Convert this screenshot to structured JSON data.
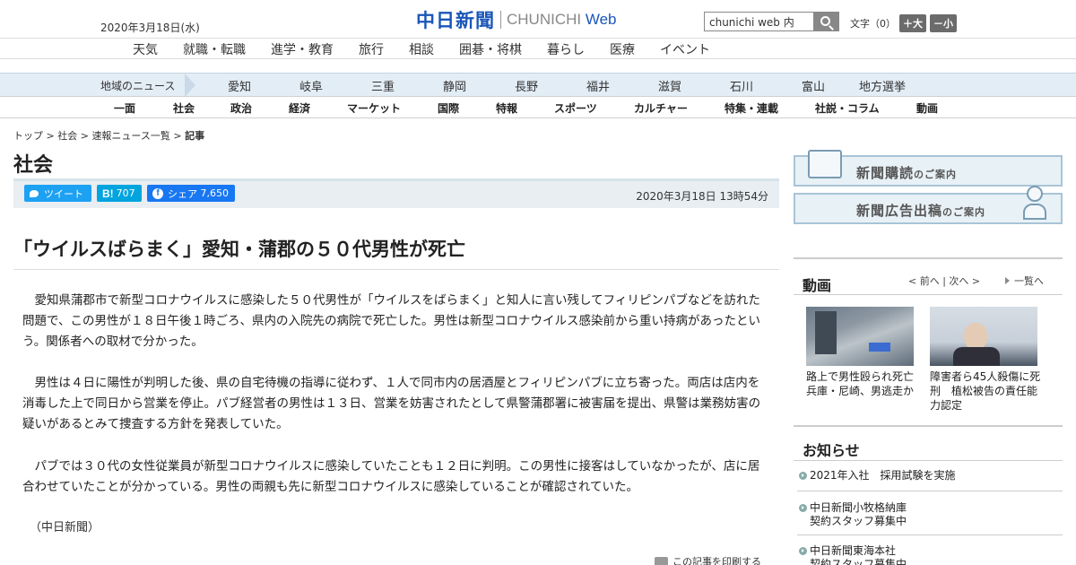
{
  "header": {
    "date": "2020年3月18日(水)",
    "logo_jp": "中日新聞",
    "logo_en_prefix": "CHUNICHI",
    "logo_en_suffix": "Web",
    "search_value": "chunichi web 内",
    "fontsize_label": "文字（0）",
    "fontsize_up": "＋大",
    "fontsize_down": "－小"
  },
  "topnav": [
    "天気",
    "就職・転職",
    "進学・教育",
    "旅行",
    "相談",
    "囲碁・将棋",
    "暮らし",
    "医療",
    "イベント"
  ],
  "region": {
    "label": "地域のニュース",
    "items": [
      "愛知",
      "岐阜",
      "三重",
      "静岡",
      "長野",
      "福井",
      "滋賀",
      "石川",
      "富山",
      "地方選挙"
    ]
  },
  "sections": [
    "一面",
    "社会",
    "政治",
    "経済",
    "マーケット",
    "国際",
    "特報",
    "スポーツ",
    "カルチャー",
    "特集・連載",
    "社説・コラム",
    "動画"
  ],
  "breadcrumb": {
    "top": "トップ",
    "sep": " > ",
    "society": "社会",
    "breaking": "速報ニュース一覧",
    "current": "記事"
  },
  "section_title": "社会",
  "share": {
    "tweet": "ツイート",
    "hatena_count": "707",
    "fb_label": "シェア",
    "fb_count": "7,650"
  },
  "pubdate": "2020年3月18日 13時54分",
  "article": {
    "headline": "「ウイルスばらまく」愛知・蒲郡の５０代男性が死亡",
    "paragraphs": [
      "愛知県蒲郡市で新型コロナウイルスに感染した５０代男性が「ウイルスをばらまく」と知人に言い残してフィリピンパブなどを訪れた問題で、この男性が１８日午後１時ごろ、県内の入院先の病院で死亡した。男性は新型コロナウイルス感染前から重い持病があったという。関係者への取材で分かった。",
      "男性は４日に陽性が判明した後、県の自宅待機の指導に従わず、１人で同市内の居酒屋とフィリピンパブに立ち寄った。両店は店内を消毒した上で同日から営業を停止。パブ経営者の男性は１３日、営業を妨害されたとして県警蒲郡署に被害届を提出、県警は業務妨害の疑いがあるとみて捜査する方針を発表していた。",
      "パブでは３０代の女性従業員が新型コロナウイルスに感染していたことも１２日に判明。この男性に接客はしていなかったが、店に居合わせていたことが分かっている。男性の両親も先に新型コロナウイルスに感染していることが確認されていた。"
    ],
    "credit": "（中日新聞）",
    "print": "この記事を印刷する"
  },
  "sidebar": {
    "banner1_main": "新聞購読",
    "banner1_sub": "のご案内",
    "banner2_main": "新聞広告出稿",
    "banner2_sub": "のご案内",
    "video_title": "動画",
    "video_nav": "< 前へ | 次へ >",
    "video_all": "一覧へ",
    "videos": [
      "路上で男性殴られ死亡　兵庫・尼崎、男逃走か",
      "障害者ら45人殺傷に死刑　植松被告の責任能力認定"
    ],
    "notice_title": "お知らせ",
    "notices": [
      "2021年入社　採用試験を実施",
      "中日新聞小牧格納庫\n契約スタッフ募集中",
      "中日新聞東海本社\n契約スタッフ募集中"
    ]
  },
  "colors": {
    "brand_blue": "#1a56b8",
    "region_bar": "#e3edf6",
    "twitter": "#1da1f2",
    "hatena": "#00a4de",
    "facebook": "#1877f2"
  }
}
